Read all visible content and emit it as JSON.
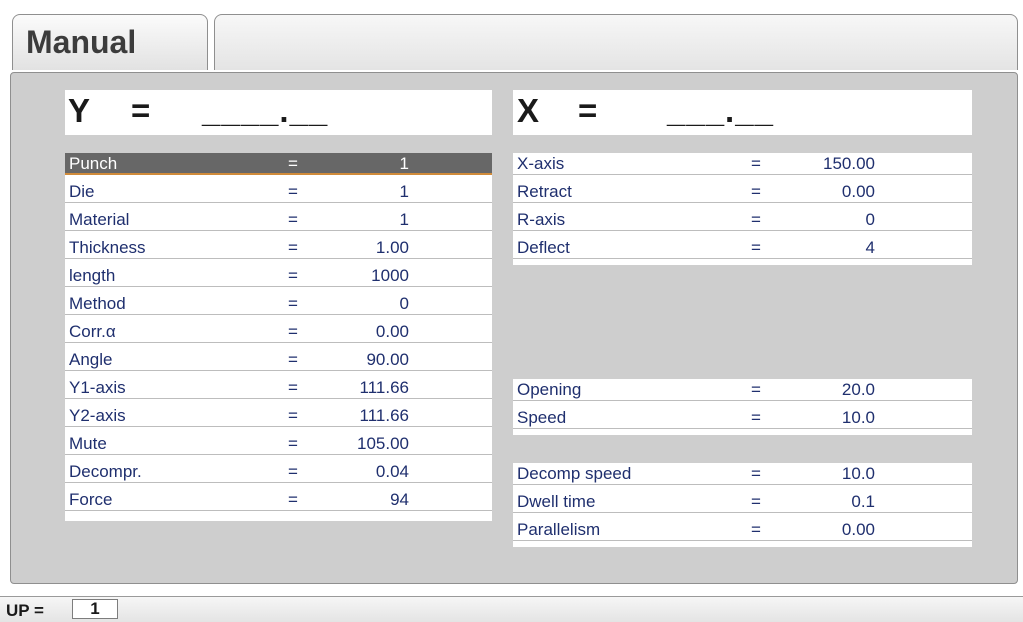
{
  "header": {
    "title": "Manual"
  },
  "positions": {
    "y": {
      "axis": "Y",
      "equals": "=",
      "value": "____.__"
    },
    "x": {
      "axis": "X",
      "equals": "=",
      "value": "___.__"
    }
  },
  "left_params": [
    {
      "label": "Punch",
      "equals": "=",
      "value": "1",
      "selected": true
    },
    {
      "label": "Die",
      "equals": "=",
      "value": "1"
    },
    {
      "label": "Material",
      "equals": "=",
      "value": "1"
    },
    {
      "label": "Thickness",
      "equals": "=",
      "value": "1.00"
    },
    {
      "label": "length",
      "equals": "=",
      "value": "1000"
    },
    {
      "label": "Method",
      "equals": "=",
      "value": "0"
    },
    {
      "label": "Corr.α",
      "equals": "=",
      "value": "0.00"
    },
    {
      "label": "Angle",
      "equals": "=",
      "value": "90.00"
    },
    {
      "label": "Y1-axis",
      "equals": "=",
      "value": "111.66"
    },
    {
      "label": "Y2-axis",
      "equals": "=",
      "value": "111.66"
    },
    {
      "label": "Mute",
      "equals": "=",
      "value": "105.00"
    },
    {
      "label": "Decompr.",
      "equals": "=",
      "value": "0.04"
    },
    {
      "label": "Force",
      "equals": "=",
      "value": "94"
    }
  ],
  "right_group1": [
    {
      "label": "X-axis",
      "equals": "=",
      "value": "150.00"
    },
    {
      "label": "Retract",
      "equals": "=",
      "value": "0.00"
    },
    {
      "label": "R-axis",
      "equals": "=",
      "value": "0"
    },
    {
      "label": "Deflect",
      "equals": "=",
      "value": "4"
    }
  ],
  "right_group2": [
    {
      "label": "Opening",
      "equals": "=",
      "value": "20.0"
    },
    {
      "label": "Speed",
      "equals": "=",
      "value": "10.0"
    }
  ],
  "right_group3": [
    {
      "label": "Decomp speed",
      "equals": "=",
      "value": "10.0"
    },
    {
      "label": "Dwell time",
      "equals": "=",
      "value": "0.1"
    },
    {
      "label": "Parallelism",
      "equals": "=",
      "value": "0.00"
    }
  ],
  "status": {
    "label": "UP =",
    "value": "1"
  },
  "colors": {
    "text_blue": "#1f2f6e",
    "panel_gray": "#cecece",
    "selected_bg": "#676767",
    "selected_accent": "#d08b3a"
  }
}
